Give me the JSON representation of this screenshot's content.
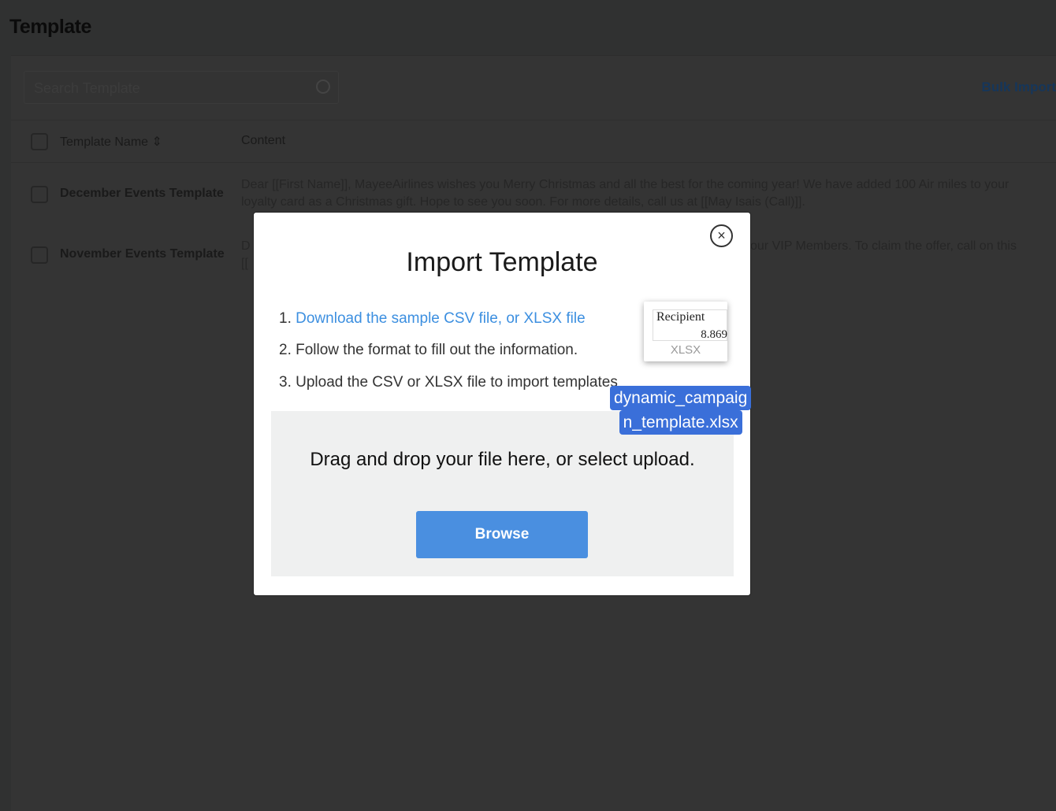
{
  "page": {
    "title": "Template"
  },
  "toolbar": {
    "search_placeholder": "Search Template",
    "bulk_import": "Bulk Import"
  },
  "table": {
    "headers": [
      "Template Name",
      "Content"
    ],
    "rows": [
      {
        "name": "December Events Template",
        "content_line1": "Dear [[First Name]], MayeeAirlines wishes you Merry Christmas and all the best for the coming year! We have added 100 Air miles to your",
        "content_line2": "loyalty card as a Christmas gift. Hope to see you soon. For more details, call us at [[May Isais (Call)]]."
      },
      {
        "name": "November Events Template",
        "content_line1": "D",
        "content_line1_tail": "our VIP Members. To claim the offer, call on this",
        "content_line2": "[["
      }
    ]
  },
  "modal": {
    "title": "Import Template",
    "close": "×",
    "step1_num": "1.",
    "step1_link": "Download the sample CSV file, or XLSX file",
    "step2": "2. Follow the format to fill out the information.",
    "step3": "3. Upload the CSV or XLSX file to import templates",
    "drop_text": "Drag and drop your file here, or select upload.",
    "browse": "Browse"
  },
  "drag_file": {
    "header": "Recipient",
    "value": "8.869",
    "type": "XLSX",
    "name_line1": "dynamic_campaig",
    "name_line2": "n_template.xlsx"
  }
}
